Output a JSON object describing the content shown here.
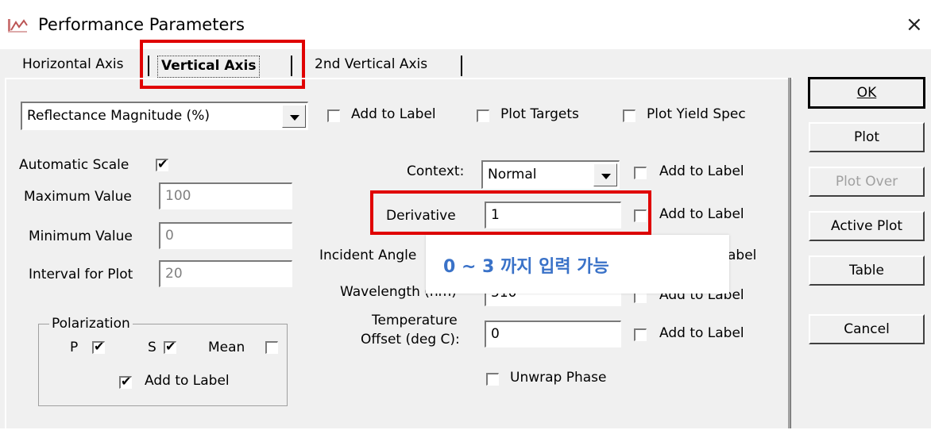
{
  "window": {
    "title": "Performance Parameters",
    "close_glyph": "×"
  },
  "tabs": [
    "Horizontal Axis",
    "Vertical Axis",
    "2nd Vertical Axis"
  ],
  "quantity": {
    "selected": "Reflectance Magnitude (%)"
  },
  "top_checks": [
    "Add to Label",
    "Plot Targets",
    "Plot Yield Spec"
  ],
  "scale": {
    "automatic_label": "Automatic Scale",
    "max_label": "Maximum Value",
    "max_value": "100",
    "min_label": "Minimum Value",
    "min_value": "0",
    "interval_label": "Interval for Plot",
    "interval_value": "20"
  },
  "polarization": {
    "legend": "Polarization",
    "p": "P",
    "s": "S",
    "mean": "Mean",
    "add_to_label": "Add to Label"
  },
  "params": {
    "context_label": "Context:",
    "context_value": "Normal",
    "derivative_label": "Derivative",
    "derivative_value": "1",
    "incident_label": "Incident Angle",
    "wavelength_label": "Wavelength (nm)",
    "wavelength_value": "510",
    "temp_label_1": "Temperature",
    "temp_label_2": "Offset (deg C):",
    "temp_value": "0",
    "add_to_label": "Add to Label",
    "add_to_label_partial": "abel",
    "unwrap_label": "Unwrap Phase"
  },
  "buttons": {
    "ok": "OK",
    "plot": "Plot",
    "plot_over": "Plot Over",
    "active_plot": "Active Plot",
    "table": "Table",
    "cancel": "Cancel"
  },
  "annotation": {
    "text": "0 ~ 3 까지 입력 가능",
    "color": "#3a72c8",
    "highlight_color": "#e00000"
  }
}
